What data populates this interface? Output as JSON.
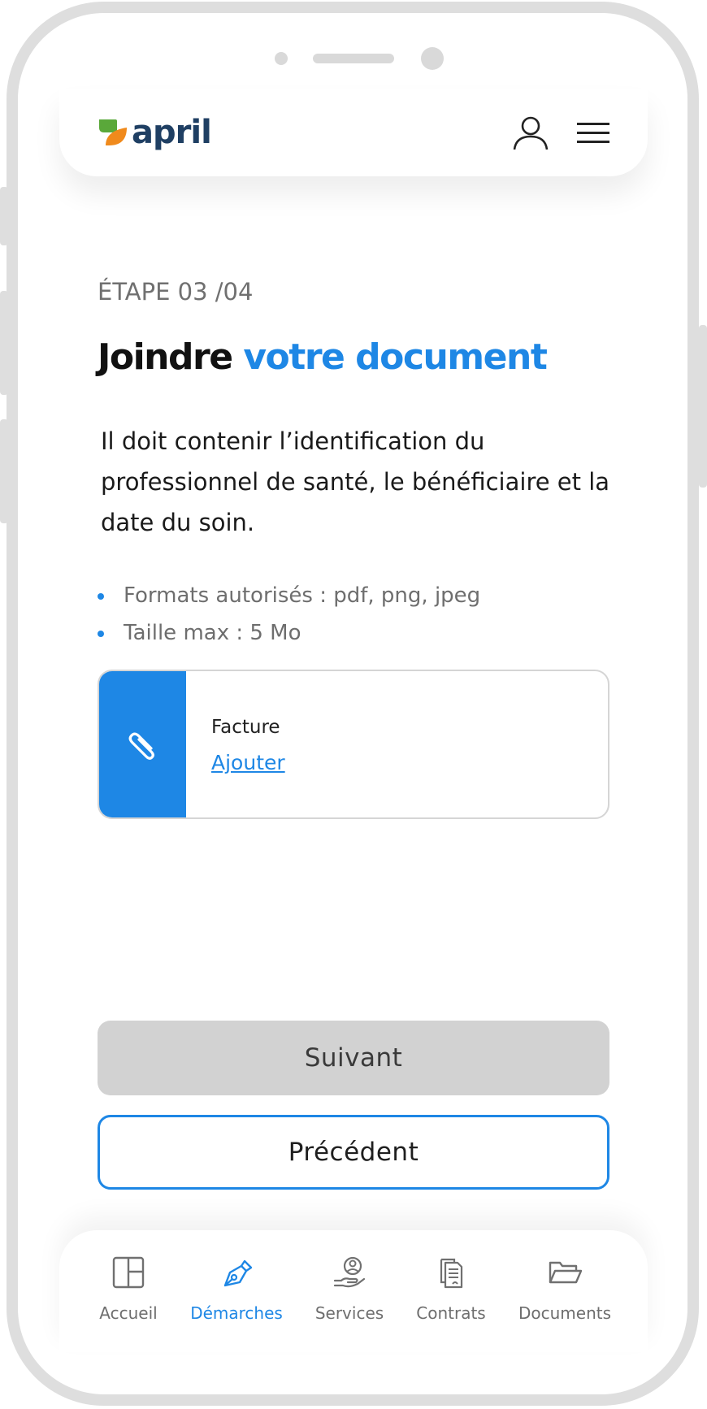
{
  "brand": {
    "name": "april",
    "text_color": "#1f3f63",
    "leaf_colors": [
      "#5aa83a",
      "#f08a1c"
    ]
  },
  "header": {
    "user_icon": "user-icon",
    "menu_icon": "hamburger-menu-icon"
  },
  "step": {
    "label": "ÉTAPE 03 /04"
  },
  "title": {
    "part1": "Joindre ",
    "part2": "votre document",
    "accent_color": "#1e87e5"
  },
  "description": "Il doit contenir l’identification du professionnel de santé, le bénéficiaire et la date du soin.",
  "requirements": [
    "Formats autorisés : pdf, png, jpeg",
    "Taille max : 5 Mo"
  ],
  "upload": {
    "label": "Facture",
    "action": "Ajouter",
    "icon": "paperclip-icon"
  },
  "buttons": {
    "next": "Suivant",
    "previous": "Précédent"
  },
  "nav": {
    "active": "Démarches",
    "items": [
      {
        "label": "Accueil",
        "icon": "home-grid-icon"
      },
      {
        "label": "Démarches",
        "icon": "pen-nib-icon"
      },
      {
        "label": "Services",
        "icon": "hand-person-icon"
      },
      {
        "label": "Contrats",
        "icon": "contract-document-icon"
      },
      {
        "label": "Documents",
        "icon": "folder-icon"
      }
    ]
  }
}
